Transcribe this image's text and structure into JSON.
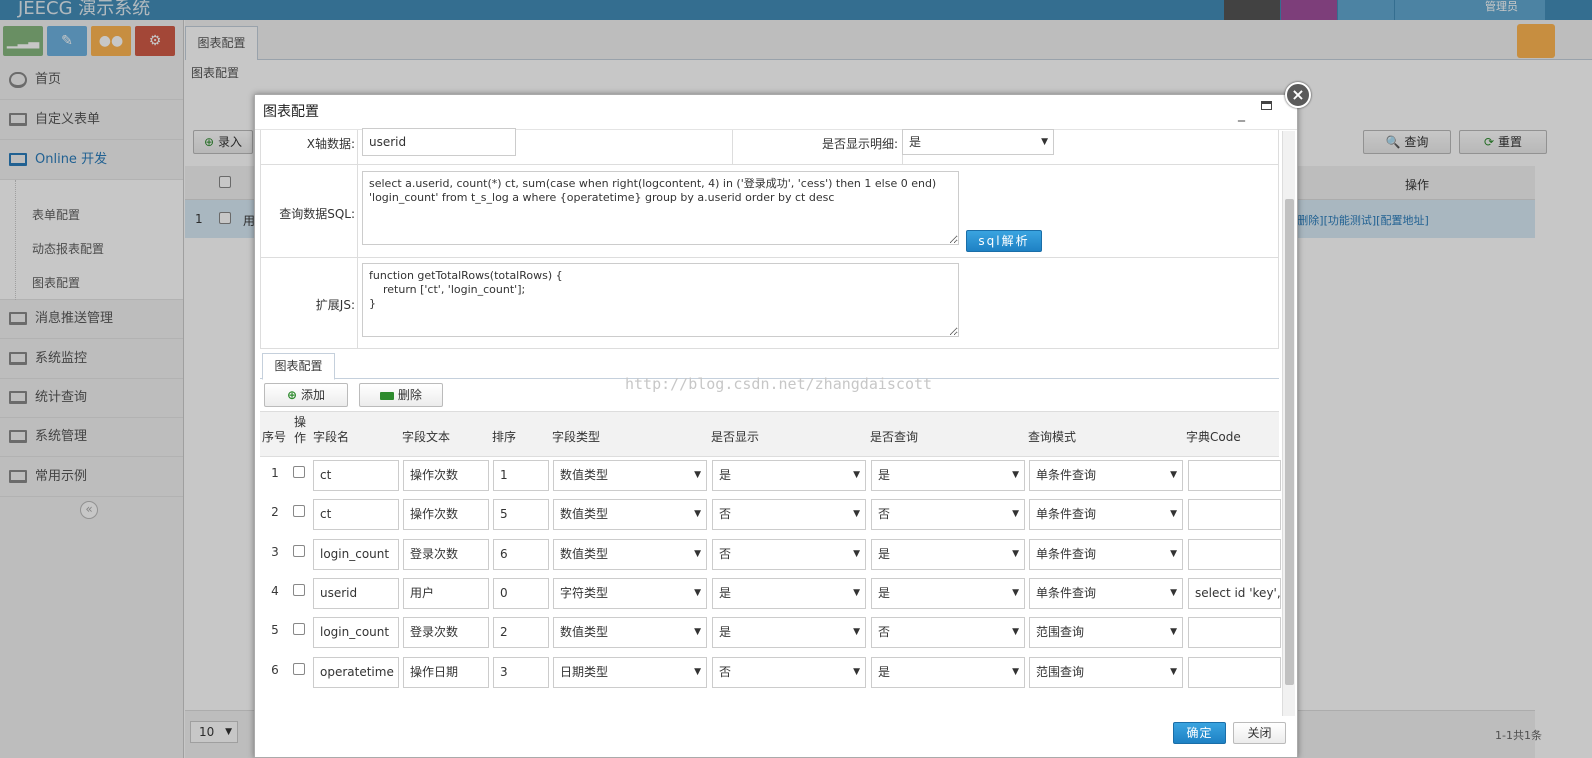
{
  "app": {
    "brand": "JEECG 演示系统",
    "user_role": "管理员"
  },
  "sidebar": {
    "shortcuts": [
      {
        "icon": "signal-icon",
        "color": "#87b87f"
      },
      {
        "icon": "pencil-icon",
        "color": "#6fb3e0"
      },
      {
        "icon": "group-icon",
        "color": "#ffb752"
      },
      {
        "icon": "cogs-icon",
        "color": "#d15b47"
      }
    ],
    "items": [
      {
        "label": "首页"
      },
      {
        "label": "自定义表单"
      },
      {
        "label": "Online 开发"
      },
      {
        "label": "消息推送管理"
      },
      {
        "label": "系统监控"
      },
      {
        "label": "统计查询"
      },
      {
        "label": "系统管理"
      },
      {
        "label": "常用示例"
      }
    ],
    "subitems": [
      {
        "label": "表单配置"
      },
      {
        "label": "动态报表配置"
      },
      {
        "label": "图表配置"
      }
    ],
    "collapse": "«"
  },
  "main": {
    "tab": "图表配置",
    "breadcrumb": "图表配置",
    "add_btn": "录入",
    "search_btn": "查询",
    "reset_btn": "重置",
    "col_action": "操作",
    "row_num": "1",
    "row_prefix": "用",
    "row_actions": "[删除][功能测试][配置地址]",
    "page_size": "10",
    "pager_info": "1-1共1条"
  },
  "dialog": {
    "title": "图表配置",
    "close": "×",
    "x_axis_label": "X轴数据:",
    "x_axis_value": "userid",
    "show_detail_label": "是否显示明细:",
    "show_detail_value": "是",
    "sql_label": "查询数据SQL:",
    "sql_value": "select a.userid, count(*) ct, sum(case when right(logcontent, 4) in ('登录成功', 'cess') then 1 else 0 end)\n'login_count' from t_s_log a where {operatetime} group by a.userid order by ct desc",
    "sql_parse_btn": "sql解析",
    "js_label": "扩展JS:",
    "js_value": "function getTotalRows(totalRows) {\n    return ['ct', 'login_count'];\n}",
    "sub_tab": "图表配置",
    "add_btn": "添加",
    "delete_btn": "删除",
    "watermark": "http://blog.csdn.net/zhangdaiscott",
    "columns": {
      "seq": "序号",
      "op": "操\n作",
      "field": "字段名",
      "text": "字段文本",
      "order": "排序",
      "type": "字段类型",
      "show": "是否显示",
      "query": "是否查询",
      "mode": "查询模式",
      "dict": "字典Code"
    },
    "rows": [
      {
        "n": "1",
        "field": "ct",
        "text": "操作次数",
        "order": "1",
        "type": "数值类型",
        "show": "是",
        "query": "是",
        "mode": "单条件查询",
        "dict": ""
      },
      {
        "n": "2",
        "field": "ct",
        "text": "操作次数",
        "order": "5",
        "type": "数值类型",
        "show": "否",
        "query": "否",
        "mode": "单条件查询",
        "dict": ""
      },
      {
        "n": "3",
        "field": "login_count",
        "text": "登录次数",
        "order": "6",
        "type": "数值类型",
        "show": "否",
        "query": "是",
        "mode": "单条件查询",
        "dict": ""
      },
      {
        "n": "4",
        "field": "userid",
        "text": "用户",
        "order": "0",
        "type": "字符类型",
        "show": "是",
        "query": "是",
        "mode": "单条件查询",
        "dict": "select id 'key', r"
      },
      {
        "n": "5",
        "field": "login_count",
        "text": "登录次数",
        "order": "2",
        "type": "数值类型",
        "show": "是",
        "query": "否",
        "mode": "范围查询",
        "dict": ""
      },
      {
        "n": "6",
        "field": "operatetime",
        "text": "操作日期",
        "order": "3",
        "type": "日期类型",
        "show": "否",
        "query": "是",
        "mode": "范围查询",
        "dict": ""
      }
    ],
    "ok_btn": "确定",
    "cancel_btn": "关闭"
  }
}
